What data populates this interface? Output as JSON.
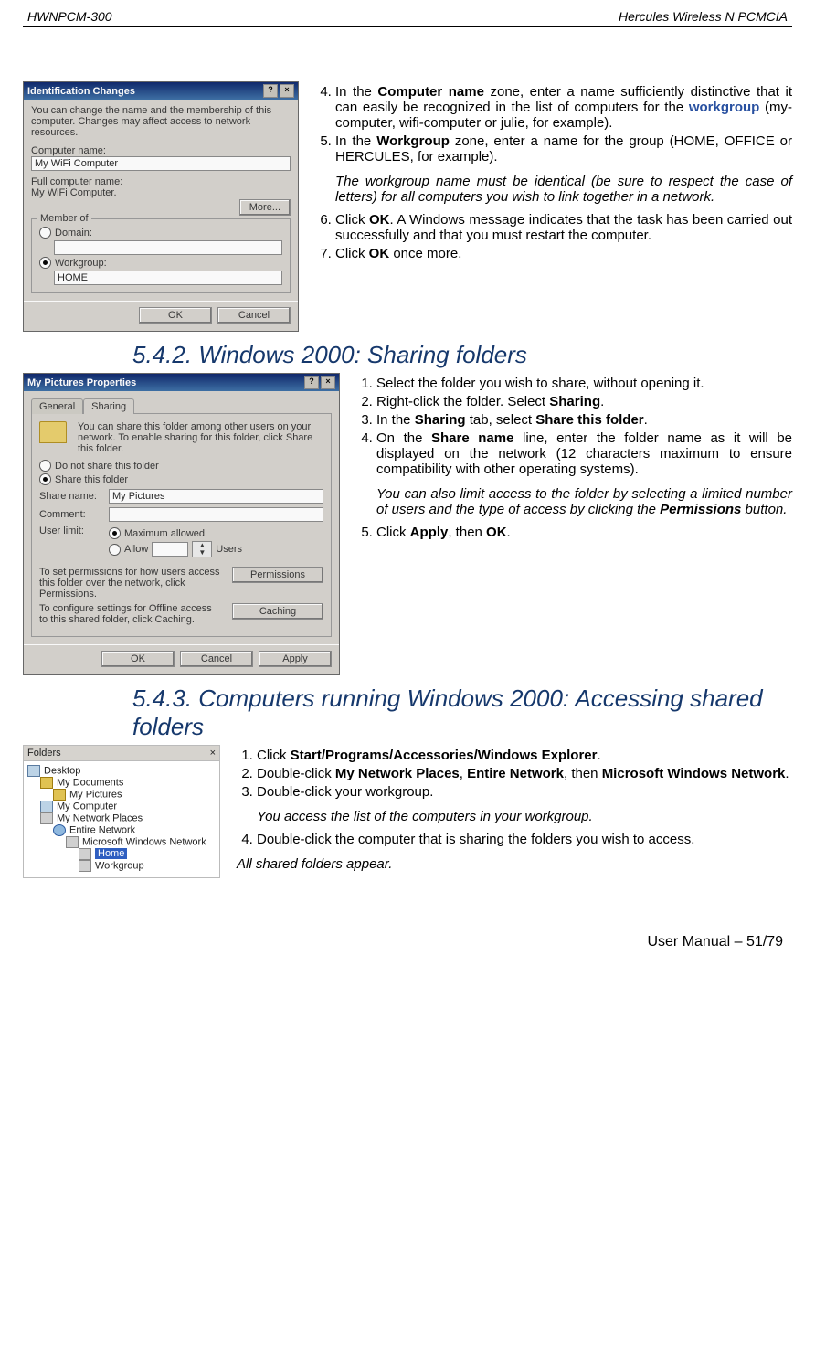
{
  "header": {
    "left": "HWNPCM-300",
    "right": "Hercules Wireless N PCMCIA"
  },
  "footer": {
    "text": "User Manual – 51/79"
  },
  "dlg1": {
    "title": "Identification Changes",
    "help_btn": "?",
    "close_btn": "×",
    "intro": "You can change the name and the membership of this computer. Changes may affect access to network resources.",
    "comp_name_label": "Computer name:",
    "comp_name_value": "My WiFi Computer",
    "full_name_label": "Full computer name:",
    "full_name_value": "My WiFi Computer.",
    "more_btn": "More...",
    "member_label": "Member of",
    "domain_label": "Domain:",
    "workgroup_label": "Workgroup:",
    "workgroup_value": "HOME",
    "ok": "OK",
    "cancel": "Cancel"
  },
  "section1": {
    "start": 4,
    "li4_a": "In the ",
    "li4_b": "Computer name",
    "li4_c": " zone, enter a name sufficiently distinctive that it can easily be recognized in the list of computers for the ",
    "li4_d": "workgroup",
    "li4_e": " (my-computer, wifi-computer or julie, for example).",
    "li5_a": "In the ",
    "li5_b": "Workgroup",
    "li5_c": " zone, enter a name for the group (HOME, OFFICE or HERCULES, for example).",
    "note": "The workgroup name must be identical (be sure to respect the case of letters) for all computers you wish to link together in a network.",
    "li6_a": "Click ",
    "li6_b": "OK",
    "li6_c": ".  A Windows message indicates that the task has been carried out successfully and that you must restart the computer.",
    "li7_a": "Click ",
    "li7_b": "OK",
    "li7_c": " once more."
  },
  "heading542": "5.4.2. Windows 2000: Sharing folders",
  "dlg2": {
    "title": "My Pictures Properties",
    "tab_general": "General",
    "tab_sharing": "Sharing",
    "intro": "You can share this folder among other users on your network.  To enable sharing for this folder, click Share this folder.",
    "opt_no": "Do not share this folder",
    "opt_yes": "Share this folder",
    "share_name_label": "Share name:",
    "share_name_value": "My Pictures",
    "comment_label": "Comment:",
    "userlimit_label": "User limit:",
    "max_label": "Maximum allowed",
    "allow_label": "Allow",
    "users_label": "Users",
    "perm_text": "To set permissions for how users access this folder over the network, click Permissions.",
    "perm_btn": "Permissions",
    "cache_text": "To configure settings for Offline access to this shared folder, click Caching.",
    "cache_btn": "Caching",
    "ok": "OK",
    "cancel": "Cancel",
    "apply": "Apply",
    "help_btn": "?",
    "close_btn": "×"
  },
  "section2": {
    "li1": "Select the folder you wish to share, without opening it.",
    "li2_a": "Right-click the folder.  Select ",
    "li2_b": "Sharing",
    "li2_c": ".",
    "li3_a": "In the ",
    "li3_b": "Sharing",
    "li3_c": " tab, select ",
    "li3_d": "Share this folder",
    "li3_e": ".",
    "li4_a": "On the ",
    "li4_b": "Share name",
    "li4_c": " line, enter the folder name as it will be displayed on the network (12 characters maximum to ensure compatibility with other operating systems).",
    "note_a": "You can also limit access to the folder by selecting a limited number of users and the type of access by clicking the ",
    "note_b": "Permissions",
    "note_c": " button.",
    "li5_a": "Click ",
    "li5_b": "Apply",
    "li5_c": ", then ",
    "li5_d": "OK",
    "li5_e": "."
  },
  "heading543": "5.4.3.  Computers running Windows 2000: Accessing shared folders",
  "tree": {
    "hd": "Folders",
    "close": "×",
    "desktop": "Desktop",
    "mydocs": "My Documents",
    "mypics": "My Pictures",
    "mycomp": "My Computer",
    "netplaces": "My Network Places",
    "entire": "Entire Network",
    "mswin": "Microsoft Windows Network",
    "home": "Home",
    "workgroup": "Workgroup"
  },
  "section3": {
    "li1_a": "Click ",
    "li1_b": "Start/Programs/Accessories/Windows Explorer",
    "li1_c": ".",
    "li2_a": "Double-click ",
    "li2_b": "My Network Places",
    "li2_c": ", ",
    "li2_d": "Entire Network",
    "li2_e": ", then ",
    "li2_f": "Microsoft Windows Network",
    "li2_g": ".",
    "li3": "Double-click your workgroup.",
    "note1": "You access the list of the computers in your workgroup.",
    "li4": "Double-click the computer that is sharing the folders you wish to access.",
    "note2": "All shared folders appear."
  }
}
